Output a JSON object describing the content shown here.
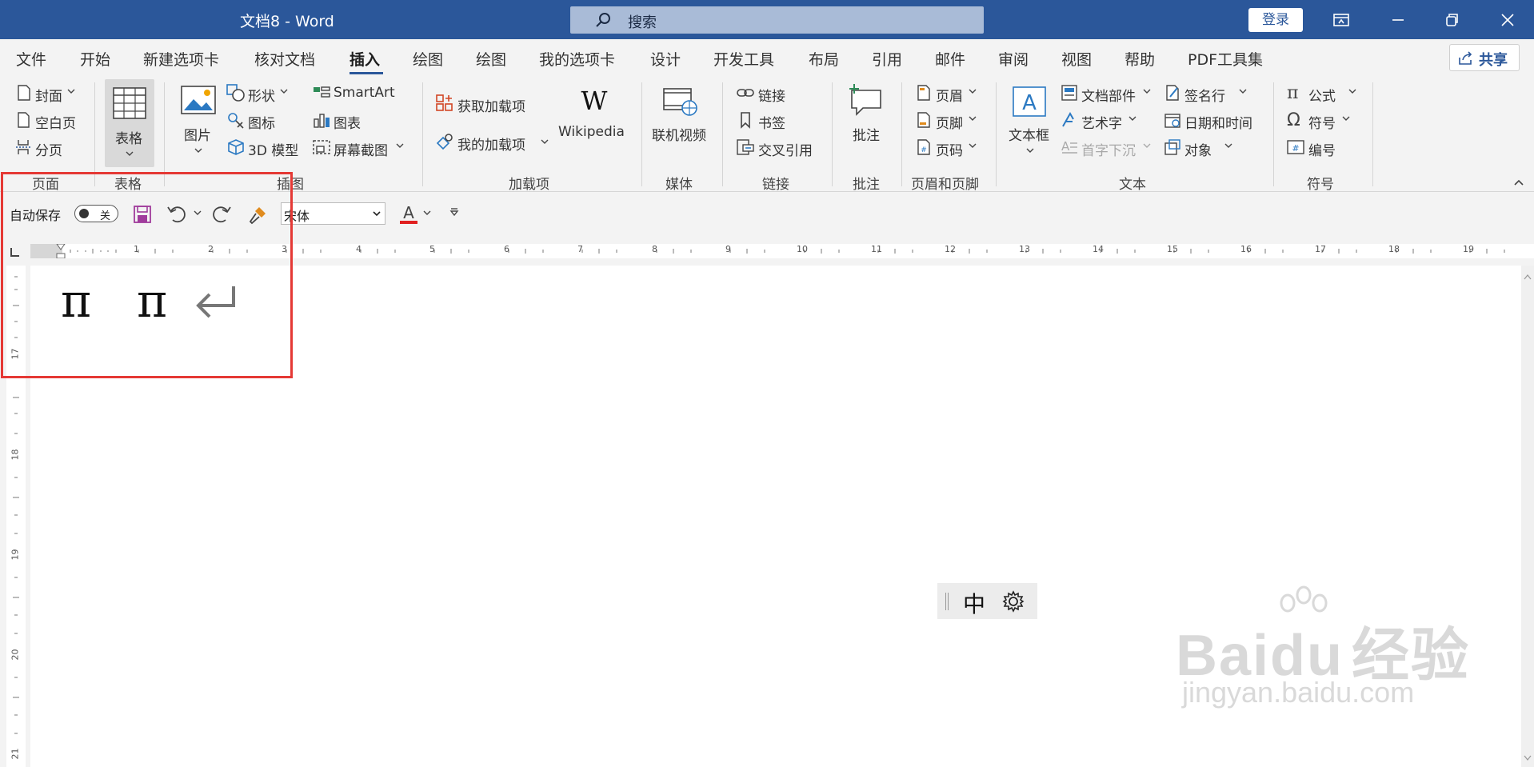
{
  "titlebar": {
    "title": "文档8  -  Word",
    "search": "搜索",
    "login": "登录"
  },
  "menu": {
    "items": [
      "文件",
      "开始",
      "新建选项卡",
      "核对文档",
      "插入",
      "绘图",
      "绘图",
      "我的选项卡",
      "设计",
      "开发工具",
      "布局",
      "引用",
      "邮件",
      "审阅",
      "视图",
      "帮助",
      "PDF工具集"
    ],
    "share": "共享"
  },
  "ribbon": {
    "pages": {
      "cover": "封面",
      "blank": "空白页",
      "break": "分页",
      "label": "页面"
    },
    "tables": {
      "table": "表格",
      "label": "表格"
    },
    "illustrations": {
      "picture": "图片",
      "shapes": "形状",
      "icons": "图标",
      "model3d": "3D 模型",
      "smartart": "SmartArt",
      "chart": "图表",
      "screenshot": "屏幕截图",
      "label": "插图"
    },
    "addins": {
      "get": "获取加载项",
      "mine": "我的加载项",
      "wikipedia": "Wikipedia",
      "label": "加载项"
    },
    "media": {
      "video": "联机视频",
      "label": "媒体"
    },
    "links": {
      "link": "链接",
      "bookmark": "书签",
      "crossref": "交叉引用",
      "label": "链接"
    },
    "comments": {
      "comment": "批注",
      "label": "批注"
    },
    "headerfooter": {
      "header": "页眉",
      "footer": "页脚",
      "pagenum": "页码",
      "label": "页眉和页脚"
    },
    "text": {
      "textbox": "文本框",
      "parts": "文档部件",
      "wordart": "艺术字",
      "dropcap": "首字下沉",
      "sigline": "签名行",
      "datetime": "日期和时间",
      "object": "对象",
      "label": "文本"
    },
    "symbols": {
      "equation": "公式",
      "symbol": "符号",
      "number": "编号",
      "label": "符号"
    }
  },
  "qat": {
    "autosave": "自动保存",
    "toggle": "关",
    "font": "宋体"
  },
  "ruler": {
    "h": [
      "1",
      "2",
      "3",
      "4",
      "5",
      "6",
      "7",
      "8",
      "9",
      "10",
      "11",
      "12",
      "13",
      "14",
      "15",
      "16",
      "17",
      "18",
      "19"
    ],
    "v": [
      "17",
      "18",
      "19",
      "20",
      "21"
    ]
  },
  "document": {
    "char1": "π",
    "char2": "π"
  },
  "ime": {
    "mode": "中"
  },
  "watermark": {
    "brand": "Bai",
    "brand2": "du",
    "cn": "经验",
    "url": "jingyan.baidu.com"
  }
}
